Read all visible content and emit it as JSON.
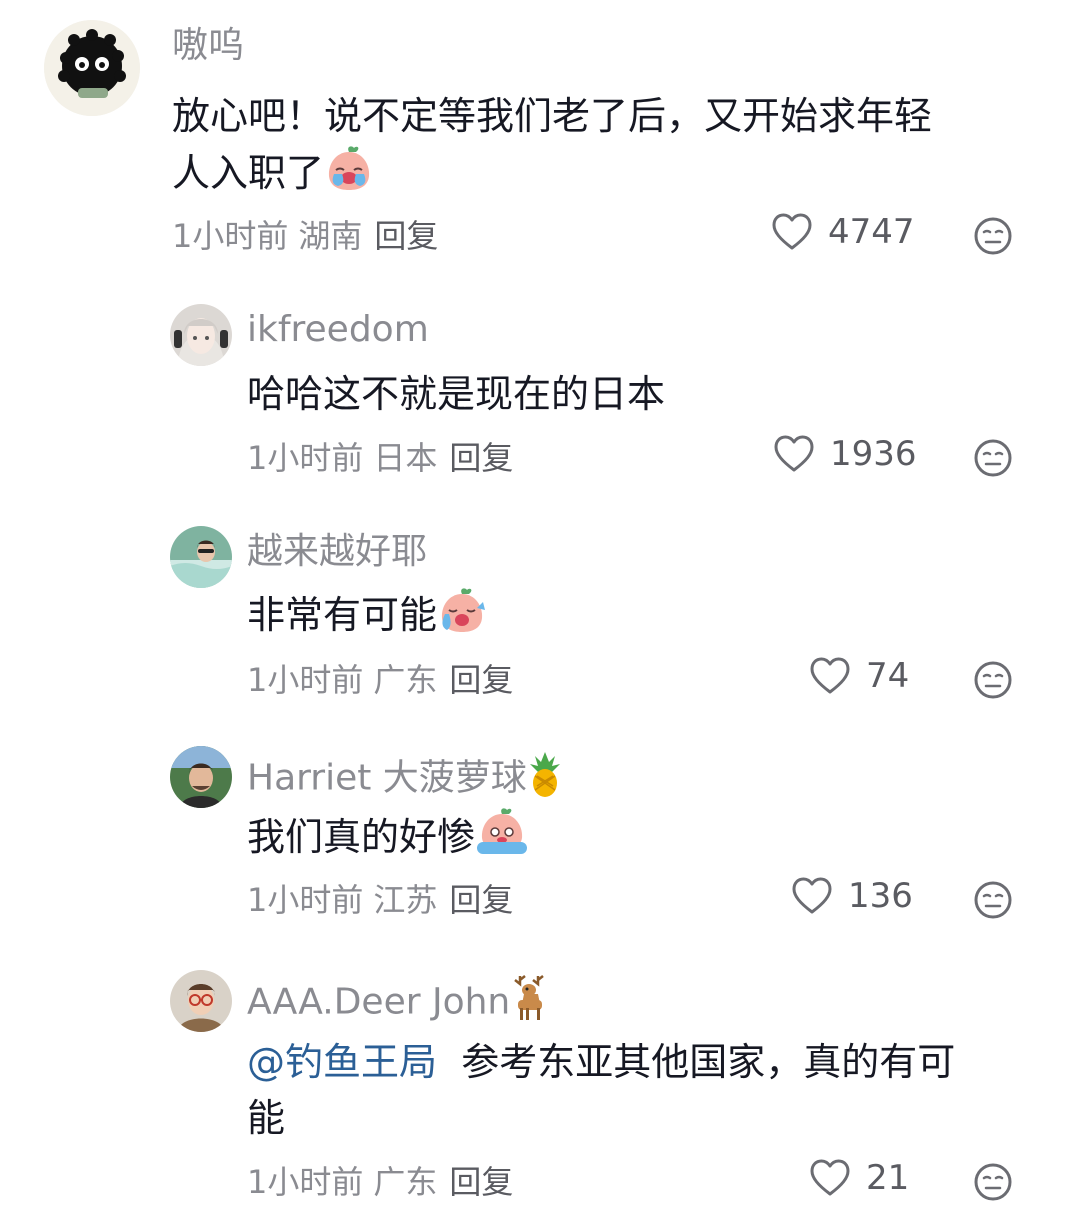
{
  "comments": [
    {
      "username": "嗷呜",
      "text_line1": "放心吧！说不定等我们老了后，又开始求年轻",
      "text_line2": "人入职了",
      "emoji": "crying-peach-emoji",
      "time": "1小时前",
      "location": "湖南",
      "reply_label": "回复",
      "likes": "4747"
    },
    {
      "username": "ikfreedom",
      "text_line1": "哈哈这不就是现在的日本",
      "time": "1小时前",
      "location": "日本",
      "reply_label": "回复",
      "likes": "1936"
    },
    {
      "username": "越来越好耶",
      "text_line1": "非常有可能",
      "emoji": "crying-peach-emoji",
      "time": "1小时前",
      "location": "广东",
      "reply_label": "回复",
      "likes": "74"
    },
    {
      "username": "Harriet 大菠萝球",
      "username_emoji": "🍍",
      "text_line1": "我们真的好惨",
      "emoji": "crying-peach-emoji",
      "time": "1小时前",
      "location": "江苏",
      "reply_label": "回复",
      "likes": "136"
    },
    {
      "username": "AAA.Deer John",
      "username_emoji": "🦌",
      "mention": "@钓鱼王局",
      "text_line1": "参考东亚其他国家，真的有可",
      "text_line2": "能",
      "time": "1小时前",
      "location": "广东",
      "reply_label": "回复",
      "likes": "21"
    }
  ],
  "colors": {
    "text": "#161823",
    "secondary": "#8a8b91",
    "mention": "#2b5f96"
  },
  "icons": [
    "heart-outline-icon",
    "dislike-face-icon"
  ]
}
